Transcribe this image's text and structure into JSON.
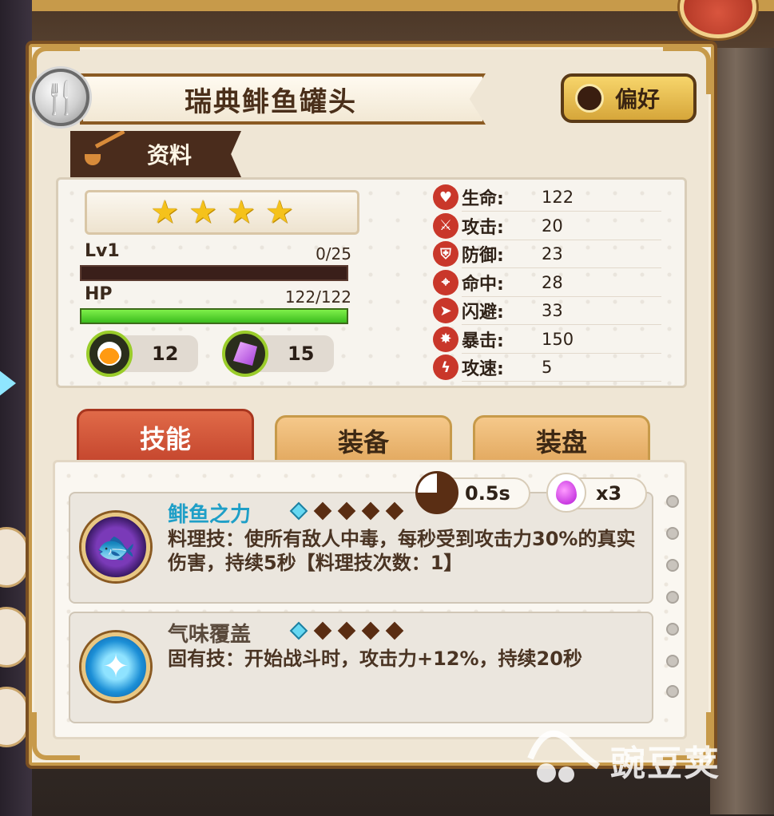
{
  "item": {
    "title": "瑞典鲱鱼罐头",
    "preference_label": "偏好",
    "info_tab_label": "资料",
    "stars": 4
  },
  "level": {
    "label": "Lv1",
    "value": "0/25",
    "progress": 0
  },
  "hp": {
    "label": "HP",
    "value": "122/122",
    "progress": 1.0
  },
  "resources": [
    {
      "icon": "potion-icon",
      "value": "12"
    },
    {
      "icon": "crystal-icon",
      "value": "15"
    }
  ],
  "stats": [
    {
      "icon": "heart-icon",
      "name": "生命:",
      "value": "122"
    },
    {
      "icon": "attack-icon",
      "name": "攻击:",
      "value": "20"
    },
    {
      "icon": "shield-icon",
      "name": "防御:",
      "value": "23"
    },
    {
      "icon": "crosshair-icon",
      "name": "命中:",
      "value": "28"
    },
    {
      "icon": "dodge-icon",
      "name": "闪避:",
      "value": "33"
    },
    {
      "icon": "crit-icon",
      "name": "暴击:",
      "value": "150"
    },
    {
      "icon": "lightning-icon",
      "name": "攻速:",
      "value": "5"
    }
  ],
  "tabs": [
    {
      "label": "技能",
      "active": true
    },
    {
      "label": "装备",
      "active": false
    },
    {
      "label": "装盘",
      "active": false
    }
  ],
  "cooldown": "0.5s",
  "uses": "x3",
  "skills": [
    {
      "name": "鲱鱼之力",
      "name_color": "#1f9fc7",
      "description": "料理技：使所有敌人中毒，每秒受到攻击力30%的真实伤害，持续5秒【料理技次数：1】",
      "icon": "fish-crown-icon"
    },
    {
      "name": "气味覆盖",
      "name_color": "#5a4a3c",
      "description": "固有技：开始战斗时，攻击力+12%，持续20秒",
      "icon": "crystal-star-icon"
    }
  ],
  "watermark": "豌豆荚",
  "colors": {
    "panel_border": "#c79a4a",
    "active_tab": "#d85a3c",
    "hp_bar": "#4fd42a"
  }
}
